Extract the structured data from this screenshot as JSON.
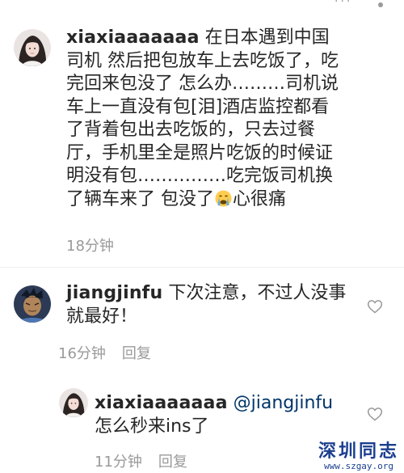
{
  "comments": [
    {
      "username": "xiaxiaaaaaaa",
      "text_part1": " 在日本遇到中国司机 然后把包放车上去吃饭了，吃完回来包没了 怎么办………司机说车上一直没有包[泪]酒店监控都看了背着包出去吃饭的，只去过餐厅，手机里全是照片吃饭的时候证明没有包……………吃完饭司机换了辆车来了 包没了",
      "emoji": "crying-face-emoji",
      "text_part2": "心很痛",
      "time": "18分钟"
    },
    {
      "username": "jiangjinfu",
      "text": " 下次注意，不过人没事就最好！",
      "time": "16分钟",
      "reply_label": "回复"
    },
    {
      "username": "xiaxiaaaaaaa",
      "mention": "@jiangjinfu",
      "text": "怎么秒来ins了",
      "time": "11分钟",
      "reply_label": "回复"
    }
  ],
  "watermark": {
    "title": "深圳同志",
    "url": "www.szgay.org"
  },
  "colors": {
    "text": "#262626",
    "meta": "#9a9a9a",
    "mention": "#003569",
    "watermark": "#1b3f8f"
  },
  "icons": [
    "heart-outline-icon",
    "crying-face-emoji"
  ]
}
